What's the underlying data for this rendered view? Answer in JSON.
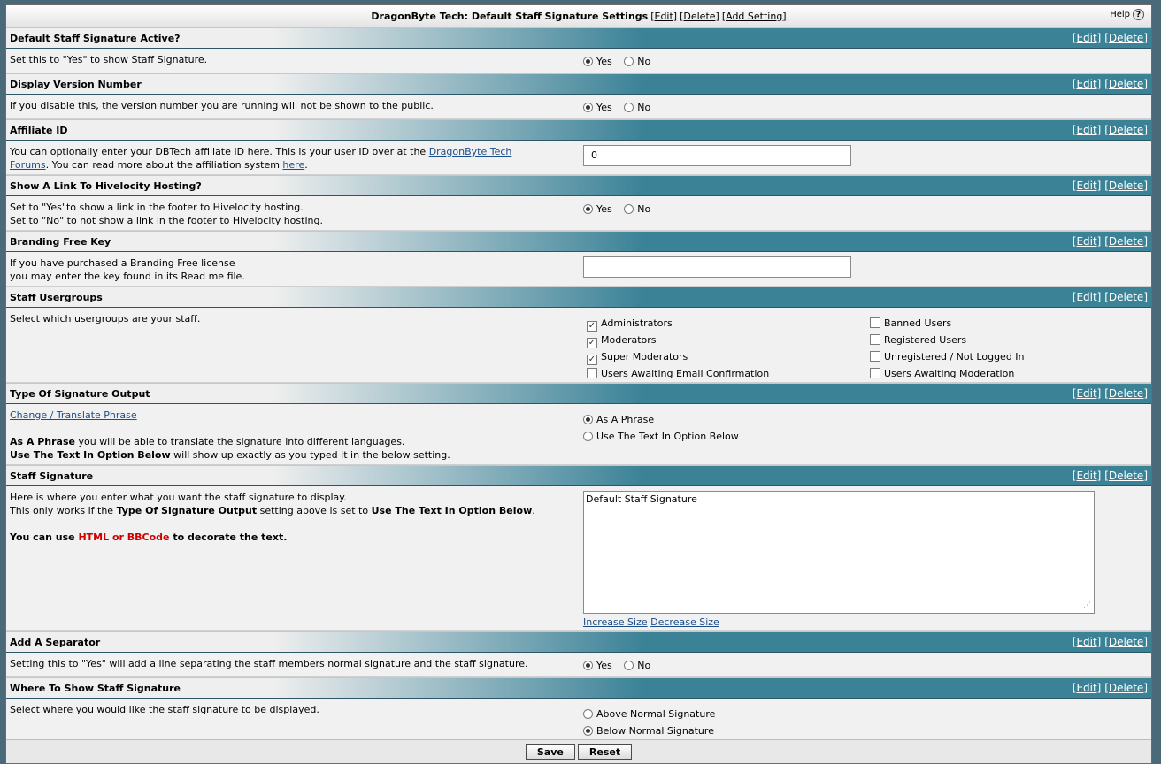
{
  "top": {
    "title": "DragonByte Tech: Default Staff Signature Settings",
    "links": [
      "[Edit]",
      "[Delete]",
      "[Add Setting]"
    ],
    "help": "Help",
    "help_icon": "question-icon"
  },
  "actions": {
    "edit": "[Edit]",
    "delete": "[Delete]"
  },
  "settings": {
    "active": {
      "title": "Default Staff Signature Active?",
      "desc": "Set this to \"Yes\" to show Staff Signature.",
      "yes": "Yes",
      "no": "No"
    },
    "version": {
      "title": "Display Version Number",
      "desc": "If you disable this, the version number you are running will not be shown to the public.",
      "yes": "Yes",
      "no": "No"
    },
    "affiliate": {
      "title": "Affiliate ID",
      "desc_a": "You can optionally enter your DBTech affiliate ID here. This is your user ID over at the ",
      "desc_link": "DragonByte Tech Forums",
      "desc_b": ". You can read more about the affiliation system ",
      "desc_here": "here",
      "desc_c": ".",
      "value": "0"
    },
    "hivelocity": {
      "title": "Show A Link To Hivelocity Hosting?",
      "desc1": "Set to \"Yes\"to show a link in the footer to Hivelocity hosting.",
      "desc2": "Set to \"No\" to not show a link in the footer to Hivelocity hosting.",
      "yes": "Yes",
      "no": "No"
    },
    "branding": {
      "title": "Branding Free Key",
      "desc1": "If you have purchased a Branding Free license",
      "desc2": "you may enter the key found in its Read me file.",
      "value": ""
    },
    "usergroups": {
      "title": "Staff Usergroups",
      "desc": "Select which usergroups are your staff.",
      "col1": [
        {
          "label": "Administrators",
          "checked": true
        },
        {
          "label": "Moderators",
          "checked": true
        },
        {
          "label": "Super Moderators",
          "checked": true
        },
        {
          "label": "Users Awaiting Email Confirmation",
          "checked": false
        }
      ],
      "col2": [
        {
          "label": "Banned Users",
          "checked": false
        },
        {
          "label": "Registered Users",
          "checked": false
        },
        {
          "label": "Unregistered / Not Logged In",
          "checked": false
        },
        {
          "label": "Users Awaiting Moderation",
          "checked": false
        }
      ]
    },
    "output": {
      "title": "Type Of Signature Output",
      "link": "Change / Translate Phrase",
      "line1_b": "As A Phrase",
      "line1": " you will be able to translate the signature into different languages.",
      "line2_b": "Use The Text In Option Below",
      "line2": " will show up exactly as you typed it in the below setting.",
      "opt1": "As A Phrase",
      "opt2": "Use The Text In Option Below"
    },
    "signature": {
      "title": "Staff Signature",
      "desc1": "Here is where you enter what you want the staff signature to display.",
      "desc2_a": "This only works if the ",
      "desc2_b": "Type Of Signature Output",
      "desc2_c": " setting above is set to ",
      "desc2_d": "Use The Text In Option Below",
      "desc2_e": ".",
      "desc3_a": "You can use ",
      "desc3_red": "HTML or BBCode",
      "desc3_c": " to decorate the text.",
      "value": "Default Staff Signature",
      "increase": "Increase Size",
      "decrease": "Decrease Size"
    },
    "separator": {
      "title": "Add A Separator",
      "desc": "Setting this to \"Yes\" will add a line separating the staff members normal signature and the staff signature.",
      "yes": "Yes",
      "no": "No"
    },
    "where": {
      "title": "Where To Show Staff Signature",
      "desc": "Select where you would like the staff signature to be displayed.",
      "opt1": "Above Normal Signature",
      "opt2": "Below Normal Signature"
    }
  },
  "footer": {
    "save": "Save",
    "reset": "Reset"
  }
}
